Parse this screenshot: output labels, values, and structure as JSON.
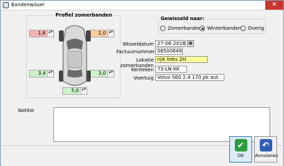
{
  "window": {
    "title": "Bandenwissel",
    "close_glyph": "✕"
  },
  "profile": {
    "title": "Profiel zomerbanden",
    "front_left": "1,6",
    "front_right": "2,0",
    "rear_left": "3,4",
    "rear_right": "3,0",
    "spare": "5,0"
  },
  "swap": {
    "title": "Gewisseld naar:",
    "options": [
      "Zomerbanden",
      "Winterbanden",
      "Overig"
    ],
    "selected": "Winterbanden"
  },
  "form": {
    "date_label": "Wisseldatum",
    "date_value": "27-06-2016",
    "invoice_label": "Factuurnummer",
    "invoice_value": "08500649",
    "location_label": "Lokatie zomerbanden",
    "location_value": "rij4 links 2H",
    "plate_label": "Kenteken",
    "plate_value": "73-LN-XK",
    "vehicle_label": "Voertuig",
    "vehicle_value": "Volvo S60 2.4 170 pk aut."
  },
  "notes": {
    "label": "Notitie",
    "value": ""
  },
  "buttons": {
    "ok": "OK",
    "cancel": "Annuleren"
  },
  "spin_glyph": "▲▼",
  "calendar_glyph": "▦",
  "ok_glyph": "✔",
  "cancel_glyph": "↶",
  "colors": {
    "red": "#f4b3b3",
    "orange": "#ffcfa2",
    "green": "#ccf2cc",
    "yellow": "#ffff99"
  }
}
